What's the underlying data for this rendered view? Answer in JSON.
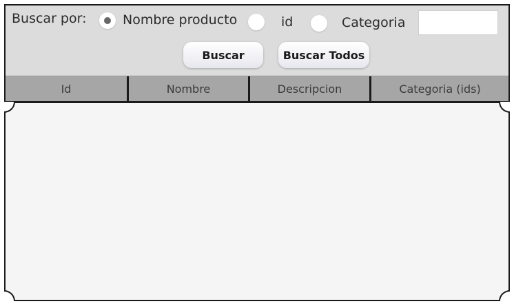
{
  "search": {
    "label": "Buscar por:",
    "options": [
      {
        "label": "Nombre producto",
        "selected": true
      },
      {
        "label": "id",
        "selected": false
      },
      {
        "label": "Categoria",
        "selected": false
      }
    ],
    "input_value": ""
  },
  "buttons": {
    "search": "Buscar",
    "search_all": "Buscar Todos"
  },
  "table": {
    "columns": [
      "Id",
      "Nombre",
      "Descripcion",
      "Categoria (ids)"
    ],
    "rows": []
  },
  "colors": {
    "panel": "#dcdcdc",
    "header": "#a6a6a6",
    "table_body": "#f5f5f5",
    "radio_dot": "#666666"
  }
}
